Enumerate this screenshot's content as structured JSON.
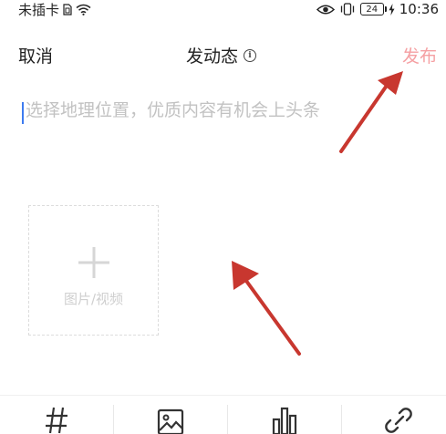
{
  "status_bar": {
    "carrier": "未插卡",
    "battery": "24",
    "time": "10:36"
  },
  "header": {
    "cancel": "取消",
    "title": "发动态",
    "publish": "发布"
  },
  "compose": {
    "placeholder": "选择地理位置，优质内容有机会上头条",
    "value": ""
  },
  "media": {
    "label": "图片/视频"
  },
  "toolbar": {
    "items": [
      "hashtag-icon",
      "image-icon",
      "chart-icon",
      "link-icon"
    ]
  },
  "colors": {
    "publish_disabled": "#f5a0a3",
    "cursor": "#3d7bf0",
    "annotation_arrow": "#c8372f"
  }
}
